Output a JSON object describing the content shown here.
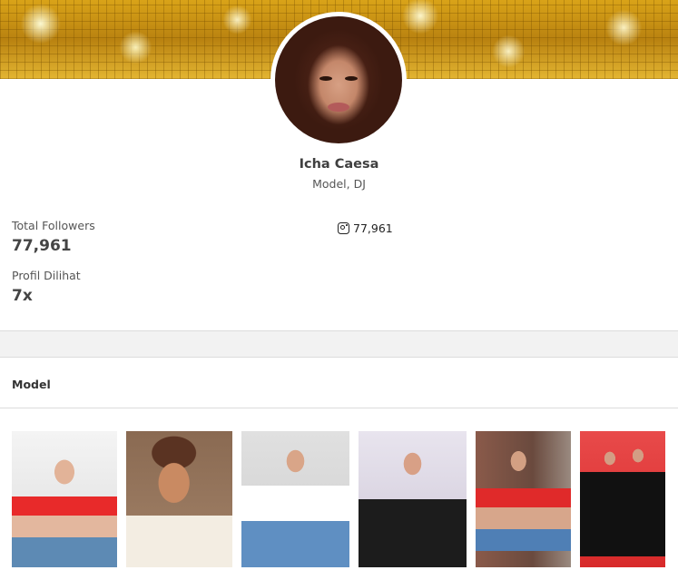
{
  "profile": {
    "name": "Icha Caesa",
    "role": "Model, DJ"
  },
  "stats": {
    "followers_label": "Total Followers",
    "followers_value": "77,961",
    "views_label": "Profil Dilihat",
    "views_value": "7x"
  },
  "instagram": {
    "icon": "instagram-icon",
    "count": "77,961"
  },
  "section": {
    "title": "Model"
  },
  "colors": {
    "banner_gold": "#c8921a",
    "band_gray": "#f2f2f2"
  }
}
